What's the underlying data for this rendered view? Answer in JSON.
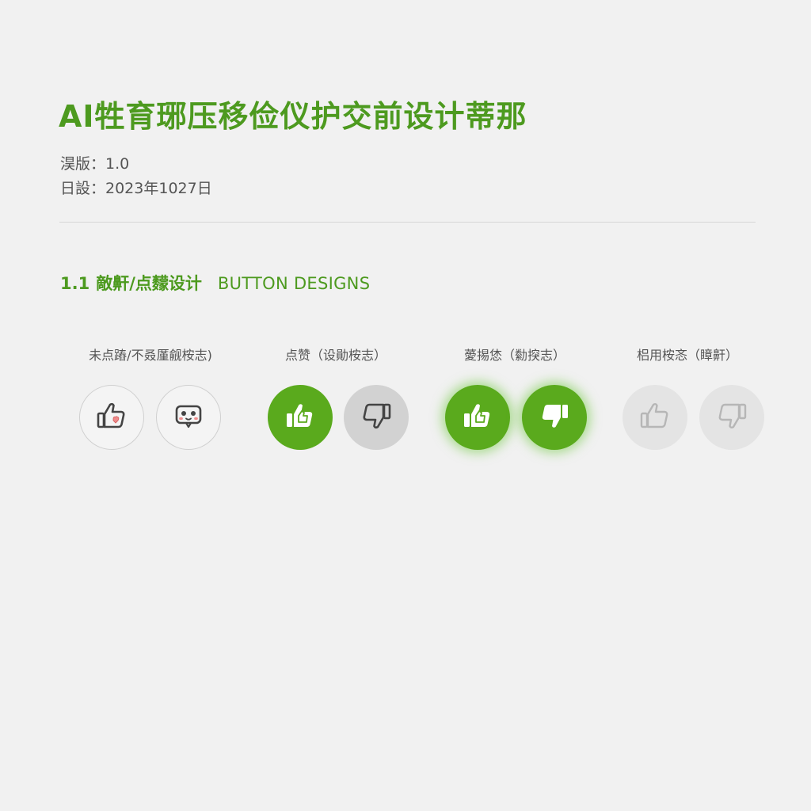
{
  "document": {
    "title": "AI牲育琊压移俭仪护交前设计蒂那",
    "version_text": "淏版：1.0",
    "date_text": "日設：2023年1027日"
  },
  "section": {
    "number": "1.1",
    "title_cn": "敵鼾/点䵆设计",
    "title_en": "BUTTON DESIGNS"
  },
  "states": [
    {
      "label": "未点蹖/不叒厪觎桉志)"
    },
    {
      "label": "点赞（设勛桉志）"
    },
    {
      "label": "薆掦恷（勬揬志）"
    },
    {
      "label": "梠用桉忞（瞕鼾）"
    }
  ],
  "buttons": [
    {
      "icon": "thumbs-up-icon",
      "state": "default"
    },
    {
      "icon": "robot-face-icon",
      "state": "default"
    },
    {
      "icon": "thumbs-up-icon",
      "state": "active"
    },
    {
      "icon": "thumbs-down-icon",
      "state": "inactive"
    },
    {
      "icon": "thumbs-up-icon",
      "state": "hover"
    },
    {
      "icon": "thumbs-down-icon",
      "state": "hover"
    },
    {
      "icon": "thumbs-up-icon",
      "state": "disabled"
    },
    {
      "icon": "thumbs-down-icon",
      "state": "disabled"
    }
  ],
  "colors": {
    "accent_green": "#5aaa1d",
    "title_green": "#4d9a1f",
    "background": "#f1f1f1",
    "inactive_grey": "#d2d2d2",
    "disabled_grey": "#e4e4e4"
  }
}
